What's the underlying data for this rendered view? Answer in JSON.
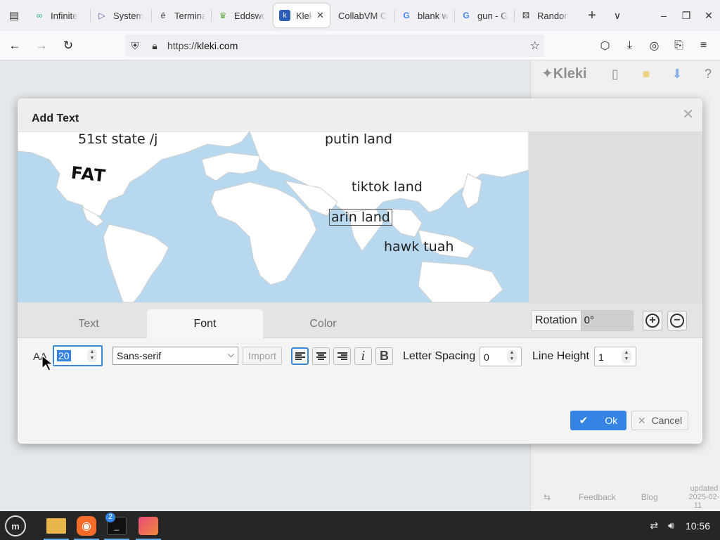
{
  "browser": {
    "tabs": [
      {
        "label": "Infinite",
        "icon": "infinity-icon"
      },
      {
        "label": "System",
        "icon": "play-icon"
      },
      {
        "label": "Termina",
        "icon": "e-accent-icon"
      },
      {
        "label": "Eddswo",
        "icon": "eddsworld-icon"
      },
      {
        "label": "Kleki",
        "icon": "kleki-icon",
        "active": true
      },
      {
        "label": "CollabVM C",
        "icon": "none"
      },
      {
        "label": "blank w",
        "icon": "google-icon"
      },
      {
        "label": "gun - G",
        "icon": "google-icon"
      },
      {
        "label": "Random",
        "icon": "dice-icon"
      }
    ],
    "url_scheme": "https://",
    "url_host": "kleki.com"
  },
  "kleki": {
    "logo": "Kleki",
    "footer": {
      "feedback": "Feedback",
      "blog": "Blog",
      "updated": "updated",
      "updated_date": "2025-02-11"
    }
  },
  "dialog": {
    "title": "Add Text",
    "preview_labels": {
      "l1": "51st state /j",
      "l2": "putin land",
      "l3": "FAT",
      "l4": "tiktok land",
      "l5": "arin land",
      "l6": "hawk tuah"
    },
    "tabs": {
      "text": "Text",
      "font": "Font",
      "color": "Color"
    },
    "rotation_label": "Rotation",
    "rotation_value": "0°",
    "size_value": "20",
    "aa_label": "AA",
    "font_family": "Sans-serif",
    "import_label": "Import",
    "italic_label": "i",
    "bold_label": "B",
    "letter_spacing_label": "Letter Spacing",
    "letter_spacing_value": "0",
    "line_height_label": "Line Height",
    "line_height_value": "1",
    "ok_label": "Ok",
    "cancel_label": "Cancel"
  },
  "taskbar": {
    "badge": "2",
    "clock": "10:56"
  },
  "colors": {
    "accent": "#3584e4",
    "ocean": "#b7d8ee",
    "land": "#ffffff"
  }
}
